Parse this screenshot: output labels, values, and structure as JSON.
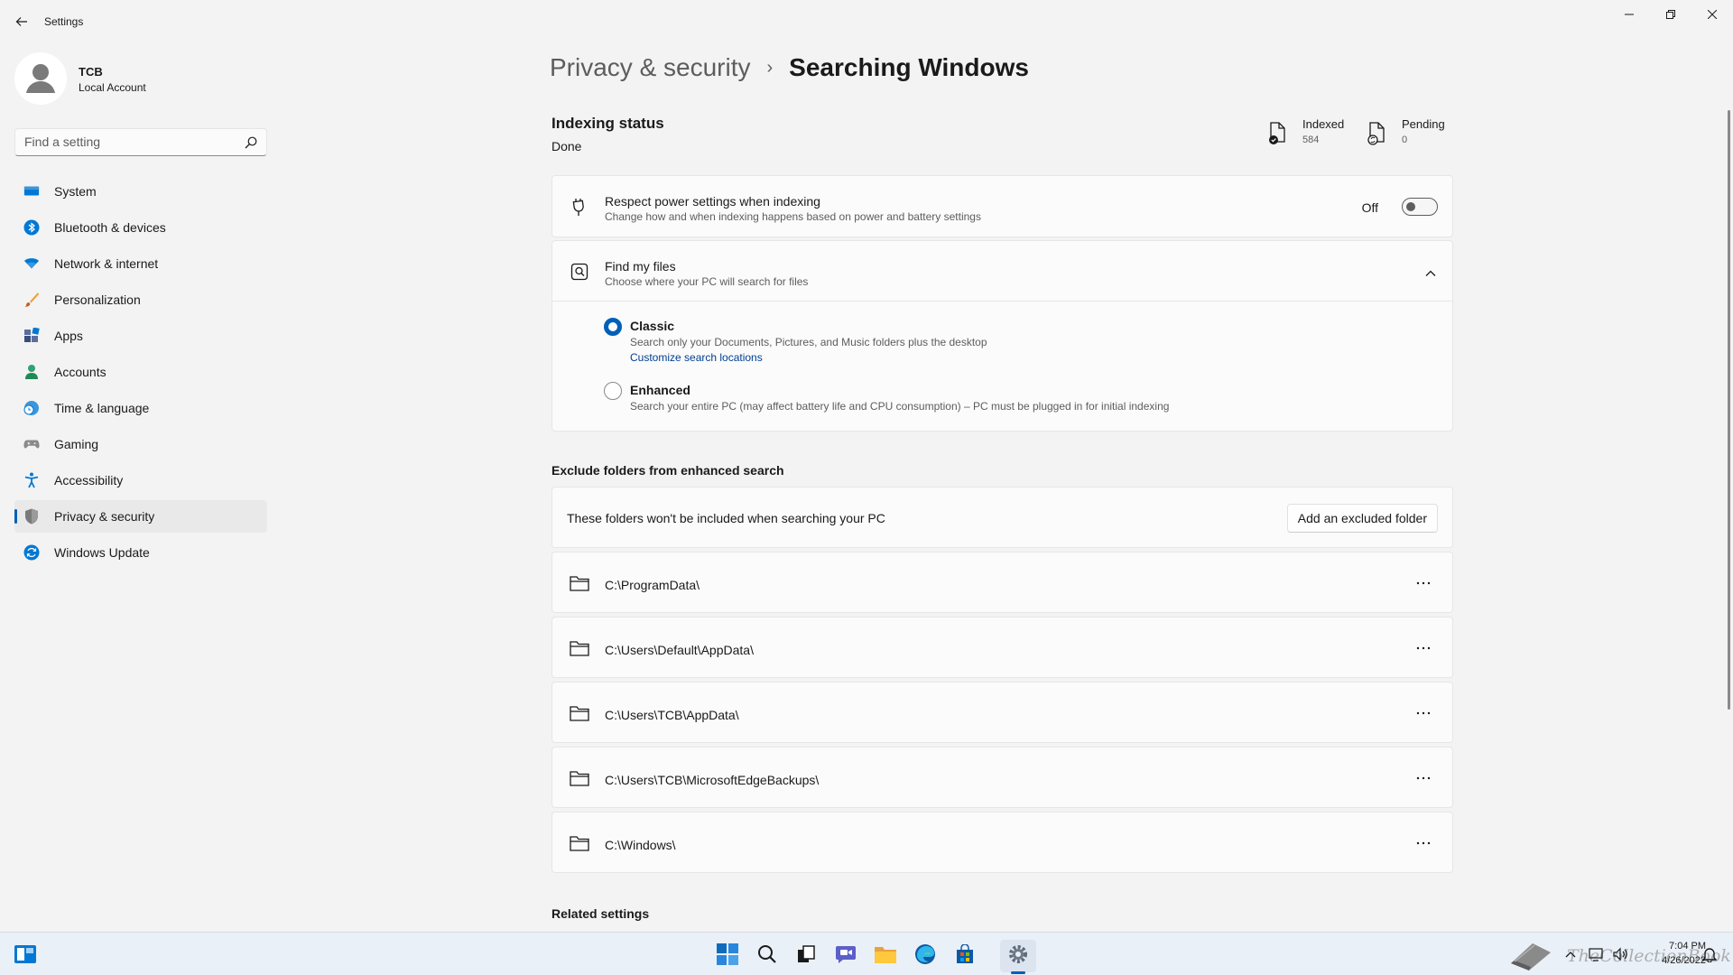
{
  "window": {
    "title": "Settings",
    "controls": [
      "minimize-icon",
      "maximize-icon",
      "close-icon"
    ]
  },
  "profile": {
    "name": "TCB",
    "account_type": "Local Account"
  },
  "search": {
    "placeholder": "Find a setting"
  },
  "sidebar": {
    "items": [
      {
        "label": "System",
        "icon": "monitor-icon"
      },
      {
        "label": "Bluetooth & devices",
        "icon": "bluetooth-icon"
      },
      {
        "label": "Network & internet",
        "icon": "wifi-icon"
      },
      {
        "label": "Personalization",
        "icon": "brush-icon"
      },
      {
        "label": "Apps",
        "icon": "apps-icon"
      },
      {
        "label": "Accounts",
        "icon": "person-icon"
      },
      {
        "label": "Time & language",
        "icon": "clock-globe-icon"
      },
      {
        "label": "Gaming",
        "icon": "gamepad-icon"
      },
      {
        "label": "Accessibility",
        "icon": "accessibility-icon"
      },
      {
        "label": "Privacy & security",
        "icon": "shield-icon",
        "selected": true
      },
      {
        "label": "Windows Update",
        "icon": "update-icon"
      }
    ]
  },
  "breadcrumb": {
    "parent": "Privacy & security",
    "separator": "›",
    "current": "Searching Windows"
  },
  "indexing": {
    "title": "Indexing status",
    "state": "Done",
    "indexed_label": "Indexed",
    "indexed_value": "584",
    "pending_label": "Pending",
    "pending_value": "0"
  },
  "power_setting": {
    "title": "Respect power settings when indexing",
    "description": "Change how and when indexing happens based on power and battery settings",
    "toggle_state_label": "Off",
    "toggle_on": false
  },
  "find_my_files": {
    "title": "Find my files",
    "description": "Choose where your PC will search for files",
    "expanded": true,
    "options": [
      {
        "label": "Classic",
        "description": "Search only your Documents, Pictures, and Music folders plus the desktop",
        "link": "Customize search locations",
        "checked": true
      },
      {
        "label": "Enhanced",
        "description": "Search your entire PC (may affect battery life and CPU consumption) – PC must be plugged in for initial indexing",
        "checked": false
      }
    ]
  },
  "exclude": {
    "title": "Exclude folders from enhanced search",
    "info": "These folders won't be included when searching your PC",
    "add_button": "Add an excluded folder",
    "folders": [
      "C:\\ProgramData\\",
      "C:\\Users\\Default\\AppData\\",
      "C:\\Users\\TCB\\AppData\\",
      "C:\\Users\\TCB\\MicrosoftEdgeBackups\\",
      "C:\\Windows\\"
    ],
    "more_label": "···"
  },
  "related": {
    "title": "Related settings"
  },
  "taskbar": {
    "apps": [
      "start-icon",
      "search-icon",
      "task-view-icon",
      "chat-icon",
      "file-explorer-icon",
      "edge-icon",
      "store-icon",
      "settings-icon"
    ],
    "active_app": "settings-icon",
    "time": "7:04 PM",
    "date": "4/26/2022",
    "watermark": "TheCollectionBook"
  },
  "colors": {
    "accent": "#005fb8",
    "background": "#f3f3f3",
    "card": "#fbfbfb",
    "link": "#003e92"
  }
}
